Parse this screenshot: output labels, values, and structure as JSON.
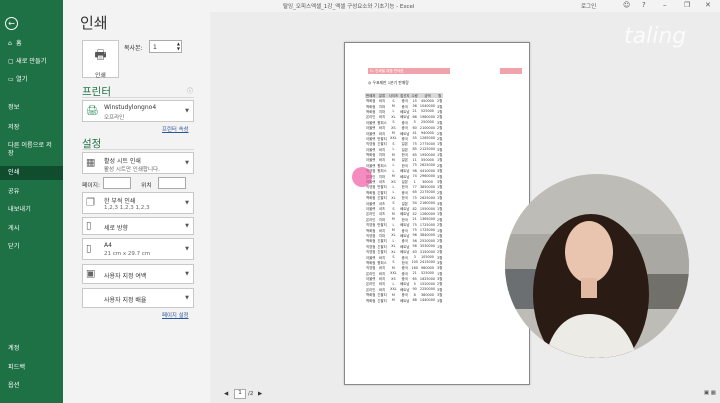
{
  "window": {
    "title": "탈잉_오피스엑셀_1강_엑셀 구성요소와 기초기능 - Excel",
    "user": "로그인",
    "smile": "☺",
    "help": "?",
    "minimize": "–",
    "restore": "❐",
    "close": "✕"
  },
  "sidebar": {
    "back": "←",
    "items": [
      {
        "label": "홈",
        "icon": "⌂"
      },
      {
        "label": "새로 만들기",
        "icon": "▢"
      },
      {
        "label": "열기",
        "icon": "▭"
      },
      {
        "label": "정보"
      },
      {
        "label": "저장"
      },
      {
        "label": "다른 이름으로 저장"
      },
      {
        "label": "인쇄"
      },
      {
        "label": "공유"
      },
      {
        "label": "내보내기"
      },
      {
        "label": "게시"
      },
      {
        "label": "닫기"
      },
      {
        "label": "계정"
      },
      {
        "label": "피드백"
      },
      {
        "label": "옵션"
      }
    ]
  },
  "print": {
    "title": "인쇄",
    "button_label": "인쇄",
    "copies_label": "복사본:",
    "copies_value": "1"
  },
  "printer": {
    "heading": "프린터",
    "name": "Winstudylongno4",
    "status": "오프라인",
    "properties_link": "프린터 속성",
    "info": "ⓘ"
  },
  "settings": {
    "heading": "설정",
    "what": {
      "t1": "활성 시트 인쇄",
      "t2": "활성 시트만 인쇄합니다."
    },
    "pages_label": "페이지:",
    "to_label": "위치",
    "collate": {
      "t1": "한 부씩 인쇄",
      "t2": "1,2,3    1,2,3    1,2,3"
    },
    "orientation": "세로 방향",
    "paper": {
      "t1": "A4",
      "t2": "21 cm x 29.7 cm"
    },
    "margins": "사용자 지정 여백",
    "scaling": "사용자 지정 배율",
    "page_setup_link": "페이지 설정"
  },
  "preview": {
    "header_title": "Q. 인쇄될 제품 판매표",
    "report_title": "◎ 우표제판 1분기 판매량",
    "columns": [
      "판매처",
      "분류",
      "사이즈",
      "접선지",
      "수량",
      "금액",
      "월"
    ],
    "rows": [
      [
        "백화점",
        "바지",
        "S",
        "중국",
        "15",
        "450000",
        "2월"
      ],
      [
        "백화점",
        "치마",
        "M",
        "중국",
        "36",
        "1040000",
        "3월"
      ],
      [
        "백화점",
        "치마",
        "L",
        "베트남",
        "21",
        "525000",
        "1월"
      ],
      [
        "온라인",
        "바지",
        "XL",
        "베트남",
        "66",
        "1980000",
        "2월"
      ],
      [
        "아울렛",
        "원피스",
        "S",
        "중국",
        "5",
        "250000",
        "3월"
      ],
      [
        "아울렛",
        "바지",
        "XS",
        "중국",
        "60",
        "2100000",
        "2월"
      ],
      [
        "아울렛",
        "바지",
        "M",
        "베트남",
        "41",
        "940000",
        "2월"
      ],
      [
        "아울렛",
        "반팔티",
        "XXL",
        "중국",
        "55",
        "1265000",
        "2월"
      ],
      [
        "직영점",
        "긴팔티",
        "S",
        "일본",
        "75",
        "2775000",
        "1월"
      ],
      [
        "아울렛",
        "바지",
        "L",
        "일본",
        "85",
        "2125000",
        "3월"
      ],
      [
        "백화점",
        "치마",
        "M",
        "한국",
        "65",
        "1950000",
        "1월"
      ],
      [
        "아울렛",
        "바지",
        "M",
        "일본",
        "11",
        "550000",
        "1월"
      ],
      [
        "아울렛",
        "원피스",
        "L",
        "한국",
        "75",
        "2625000",
        "2월"
      ],
      [
        "직영점",
        "원피스",
        "L",
        "베트남",
        "98",
        "4410000",
        "3월"
      ],
      [
        "온라인",
        "치마",
        "M",
        "베트남",
        "74",
        "2960000",
        "3월"
      ],
      [
        "아울렛",
        "셔츠",
        "XS",
        "일본",
        "1",
        "30000",
        "3월"
      ],
      [
        "직영점",
        "반팔티",
        "L",
        "한국",
        "77",
        "3850000",
        "1월"
      ],
      [
        "백화점",
        "긴팔티",
        "L",
        "중국",
        "65",
        "2275000",
        "2월"
      ],
      [
        "백화점",
        "긴팔티",
        "XL",
        "한국",
        "75",
        "2625000",
        "1월"
      ],
      [
        "아울렛",
        "셔츠",
        "S",
        "일본",
        "54",
        "2160000",
        "3월"
      ],
      [
        "아울렛",
        "셔츠",
        "S",
        "베트남",
        "82",
        "1550000",
        "1월"
      ],
      [
        "온라인",
        "셔츠",
        "M",
        "베트남",
        "42",
        "1260000",
        "1월"
      ],
      [
        "온라인",
        "치마",
        "M",
        "한국",
        "21",
        "1365000",
        "2월"
      ],
      [
        "직영점",
        "반팔티",
        "L",
        "베트남",
        "75",
        "1725000",
        "2월"
      ],
      [
        "백화점",
        "바지",
        "M",
        "중국",
        "75",
        "1725000",
        "1월"
      ],
      [
        "직영점",
        "치마",
        "XL",
        "베트남",
        "96",
        "3840000",
        "1월"
      ],
      [
        "백화점",
        "긴팔티",
        "L",
        "중국",
        "56",
        "2520000",
        "2월"
      ],
      [
        "직영점",
        "긴팔티",
        "XL",
        "베트남",
        "56",
        "3530000",
        "1월"
      ],
      [
        "직영점",
        "긴팔티",
        "XL",
        "베트남",
        "63",
        "3150000",
        "2월"
      ],
      [
        "아울렛",
        "바지",
        "S",
        "중국",
        "3",
        "105000",
        "3월"
      ],
      [
        "백화점",
        "원피스",
        "S",
        "한국",
        "105",
        "2415000",
        "3월"
      ],
      [
        "직영점",
        "바지",
        "M",
        "중국",
        "160",
        "980000",
        "3월"
      ],
      [
        "온라인",
        "바지",
        "XXL",
        "중국",
        "21",
        "525000",
        "1월"
      ],
      [
        "아울렛",
        "바지",
        "XS",
        "중국",
        "65",
        "1625000",
        "3월"
      ],
      [
        "온라인",
        "바지",
        "L",
        "베트남",
        "5",
        "1520000",
        "2월"
      ],
      [
        "온라인",
        "바지",
        "XXL",
        "베트남",
        "90",
        "2250000",
        "3월"
      ],
      [
        "백화점",
        "긴팔티",
        "M",
        "중국",
        "8",
        "360000",
        "3월"
      ],
      [
        "백화점",
        "긴팔티",
        "M",
        "베트남",
        "68",
        "1440000",
        "3월"
      ]
    ]
  },
  "pager": {
    "current": "1",
    "total": "/2",
    "prev": "◀",
    "next": "▶"
  },
  "watermark": "taling"
}
